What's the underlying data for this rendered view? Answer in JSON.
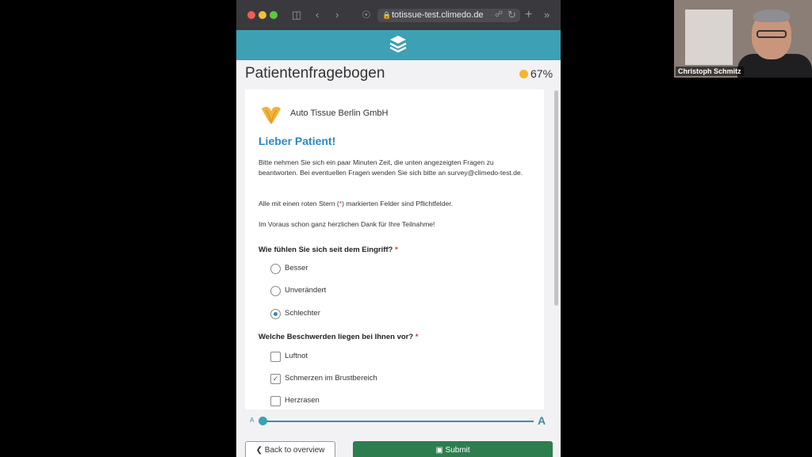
{
  "browser": {
    "url": "totissue-test.climedo.de"
  },
  "page": {
    "title": "Patientenfragebogen",
    "progress": "67%"
  },
  "survey": {
    "org_name": "Auto Tissue Berlin GmbH",
    "greeting": "Lieber Patient!",
    "intro_text": "Bitte nehmen Sie sich ein paar Minuten Zeit, die unten angezeigten Fragen zu beantworten. Bei eventuellen Fragen wenden Sie sich bitte an survey@climedo-test.de.",
    "required_prefix": "Alle mit einen roten Stern (",
    "required_star": "*",
    "required_suffix": ") markierten Felder sind Pflichtfelder.",
    "thanks_text": "Im Voraus schon ganz herzlichen Dank für Ihre Teilnahme!",
    "questions": [
      {
        "label": "Wie fühlen Sie sich seit dem Eingriff?",
        "required_mark": "*",
        "type": "radio",
        "options": [
          {
            "label": "Besser",
            "selected": false
          },
          {
            "label": "Unverändert",
            "selected": false
          },
          {
            "label": "Schlechter",
            "selected": true
          }
        ]
      },
      {
        "label": "Welche Beschwerden liegen bei Ihnen vor?",
        "required_mark": "*",
        "type": "checkbox",
        "options": [
          {
            "label": "Luftnot",
            "checked": false
          },
          {
            "label": "Schmerzen im Brustbereich",
            "checked": true
          },
          {
            "label": "Herzrasen",
            "checked": false
          }
        ]
      }
    ]
  },
  "font_slider": {
    "small_label": "A",
    "large_label": "A",
    "value": 0
  },
  "footer": {
    "back_label": "Back to overview",
    "submit_label": "Submit"
  },
  "video": {
    "participant_name": "Christoph Schmitz"
  },
  "colors": {
    "accent": "#3da0b4",
    "heading_blue": "#2a88c8",
    "submit_green": "#2e7d4f",
    "progress_dot": "#f2b632"
  }
}
